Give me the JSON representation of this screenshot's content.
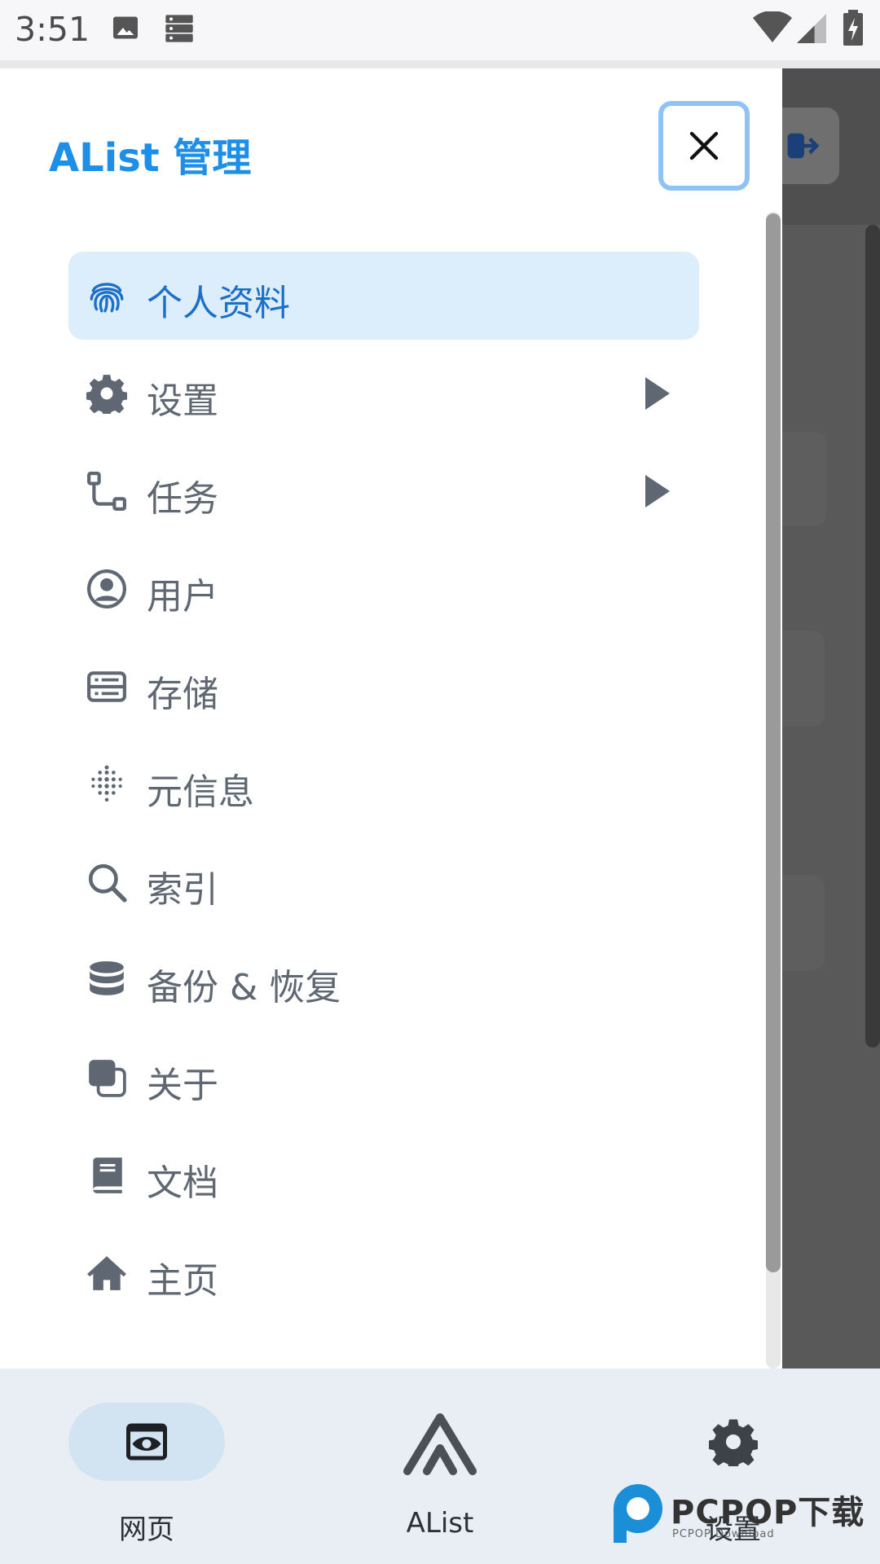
{
  "status_bar": {
    "time": "3:51",
    "icons": [
      "image-icon",
      "storage-icon",
      "wifi-icon",
      "signal-icon",
      "battery-icon"
    ]
  },
  "drawer": {
    "title": "AList 管理",
    "close_icon": "close-icon",
    "items": [
      {
        "label": "个人资料",
        "icon": "fingerprint-icon",
        "active": true,
        "has_submenu": false
      },
      {
        "label": "设置",
        "icon": "gear-icon",
        "active": false,
        "has_submenu": true
      },
      {
        "label": "任务",
        "icon": "workflow-icon",
        "active": false,
        "has_submenu": true
      },
      {
        "label": "用户",
        "icon": "user-circle-icon",
        "active": false,
        "has_submenu": false
      },
      {
        "label": "存储",
        "icon": "storage-icon",
        "active": false,
        "has_submenu": false
      },
      {
        "label": "元信息",
        "icon": "dots-grid-icon",
        "active": false,
        "has_submenu": false
      },
      {
        "label": "索引",
        "icon": "search-icon",
        "active": false,
        "has_submenu": false
      },
      {
        "label": "备份 & 恢复",
        "icon": "database-icon",
        "active": false,
        "has_submenu": false
      },
      {
        "label": "关于",
        "icon": "copy-squares-icon",
        "active": false,
        "has_submenu": false
      },
      {
        "label": "文档",
        "icon": "book-icon",
        "active": false,
        "has_submenu": false
      },
      {
        "label": "主页",
        "icon": "home-icon",
        "active": false,
        "has_submenu": false
      }
    ]
  },
  "bottom_nav": {
    "items": [
      {
        "label": "网页",
        "icon": "eye-window-icon",
        "active": true
      },
      {
        "label": "AList",
        "icon": "alist-logo-icon",
        "active": false
      },
      {
        "label": "设置",
        "icon": "gear-icon",
        "active": false
      }
    ]
  },
  "watermark": {
    "text": "PCPOP下载",
    "subtext": "PCPOP Download"
  },
  "colors": {
    "accent": "#1e8fe9",
    "active_bg": "#dcedfb",
    "text_gray": "#5f6872",
    "nav_bg": "#e9eef4"
  }
}
